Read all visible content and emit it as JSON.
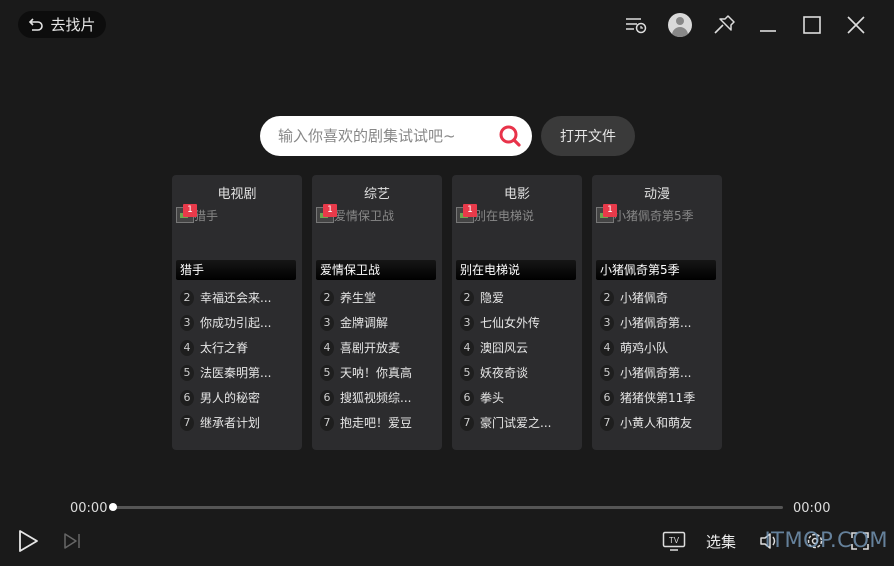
{
  "header": {
    "back_label": "去找片"
  },
  "search": {
    "placeholder": "输入你喜欢的剧集试试吧~",
    "value": ""
  },
  "open_file_label": "打开文件",
  "categories": [
    {
      "title": "电视剧",
      "poster_alt": "猎手",
      "badge": "1",
      "top_title": "猎手",
      "items": [
        {
          "rank": "2",
          "title": "幸福还会来..."
        },
        {
          "rank": "3",
          "title": "你成功引起..."
        },
        {
          "rank": "4",
          "title": "太行之脊"
        },
        {
          "rank": "5",
          "title": "法医秦明第..."
        },
        {
          "rank": "6",
          "title": "男人的秘密"
        },
        {
          "rank": "7",
          "title": "继承者计划"
        }
      ]
    },
    {
      "title": "综艺",
      "poster_alt": "爱情保卫战",
      "badge": "1",
      "top_title": "爱情保卫战",
      "items": [
        {
          "rank": "2",
          "title": "养生堂"
        },
        {
          "rank": "3",
          "title": "金牌调解"
        },
        {
          "rank": "4",
          "title": "喜剧开放麦"
        },
        {
          "rank": "5",
          "title": "天呐！你真高"
        },
        {
          "rank": "6",
          "title": "搜狐视频综..."
        },
        {
          "rank": "7",
          "title": "抱走吧！爱豆"
        }
      ]
    },
    {
      "title": "电影",
      "poster_alt": "别在电梯说",
      "badge": "1",
      "top_title": "别在电梯说",
      "items": [
        {
          "rank": "2",
          "title": "隐爱"
        },
        {
          "rank": "3",
          "title": "七仙女外传"
        },
        {
          "rank": "4",
          "title": "澳囧风云"
        },
        {
          "rank": "5",
          "title": "妖夜奇谈"
        },
        {
          "rank": "6",
          "title": "拳头"
        },
        {
          "rank": "7",
          "title": "豪门试爱之..."
        }
      ]
    },
    {
      "title": "动漫",
      "poster_alt": "小猪佩奇第5季",
      "badge": "1",
      "top_title": "小猪佩奇第5季",
      "items": [
        {
          "rank": "2",
          "title": "小猪佩奇"
        },
        {
          "rank": "3",
          "title": "小猪佩奇第..."
        },
        {
          "rank": "4",
          "title": "萌鸡小队"
        },
        {
          "rank": "5",
          "title": "小猪佩奇第..."
        },
        {
          "rank": "6",
          "title": "猪猪侠第11季"
        },
        {
          "rank": "7",
          "title": "小黄人和萌友"
        }
      ]
    }
  ],
  "player": {
    "current_time": "00:00",
    "total_time": "00:00",
    "progress": 0,
    "episodes_label": "选集",
    "tv_label": "TV"
  },
  "watermark": "ITMOP.COM",
  "icons": [
    "back-arrow-icon",
    "playlist-icon",
    "avatar-icon",
    "pin-icon",
    "minimize-icon",
    "maximize-icon",
    "close-icon",
    "search-icon",
    "play-icon",
    "next-icon",
    "tv-cast-icon",
    "volume-icon",
    "settings-icon",
    "fullscreen-icon"
  ]
}
